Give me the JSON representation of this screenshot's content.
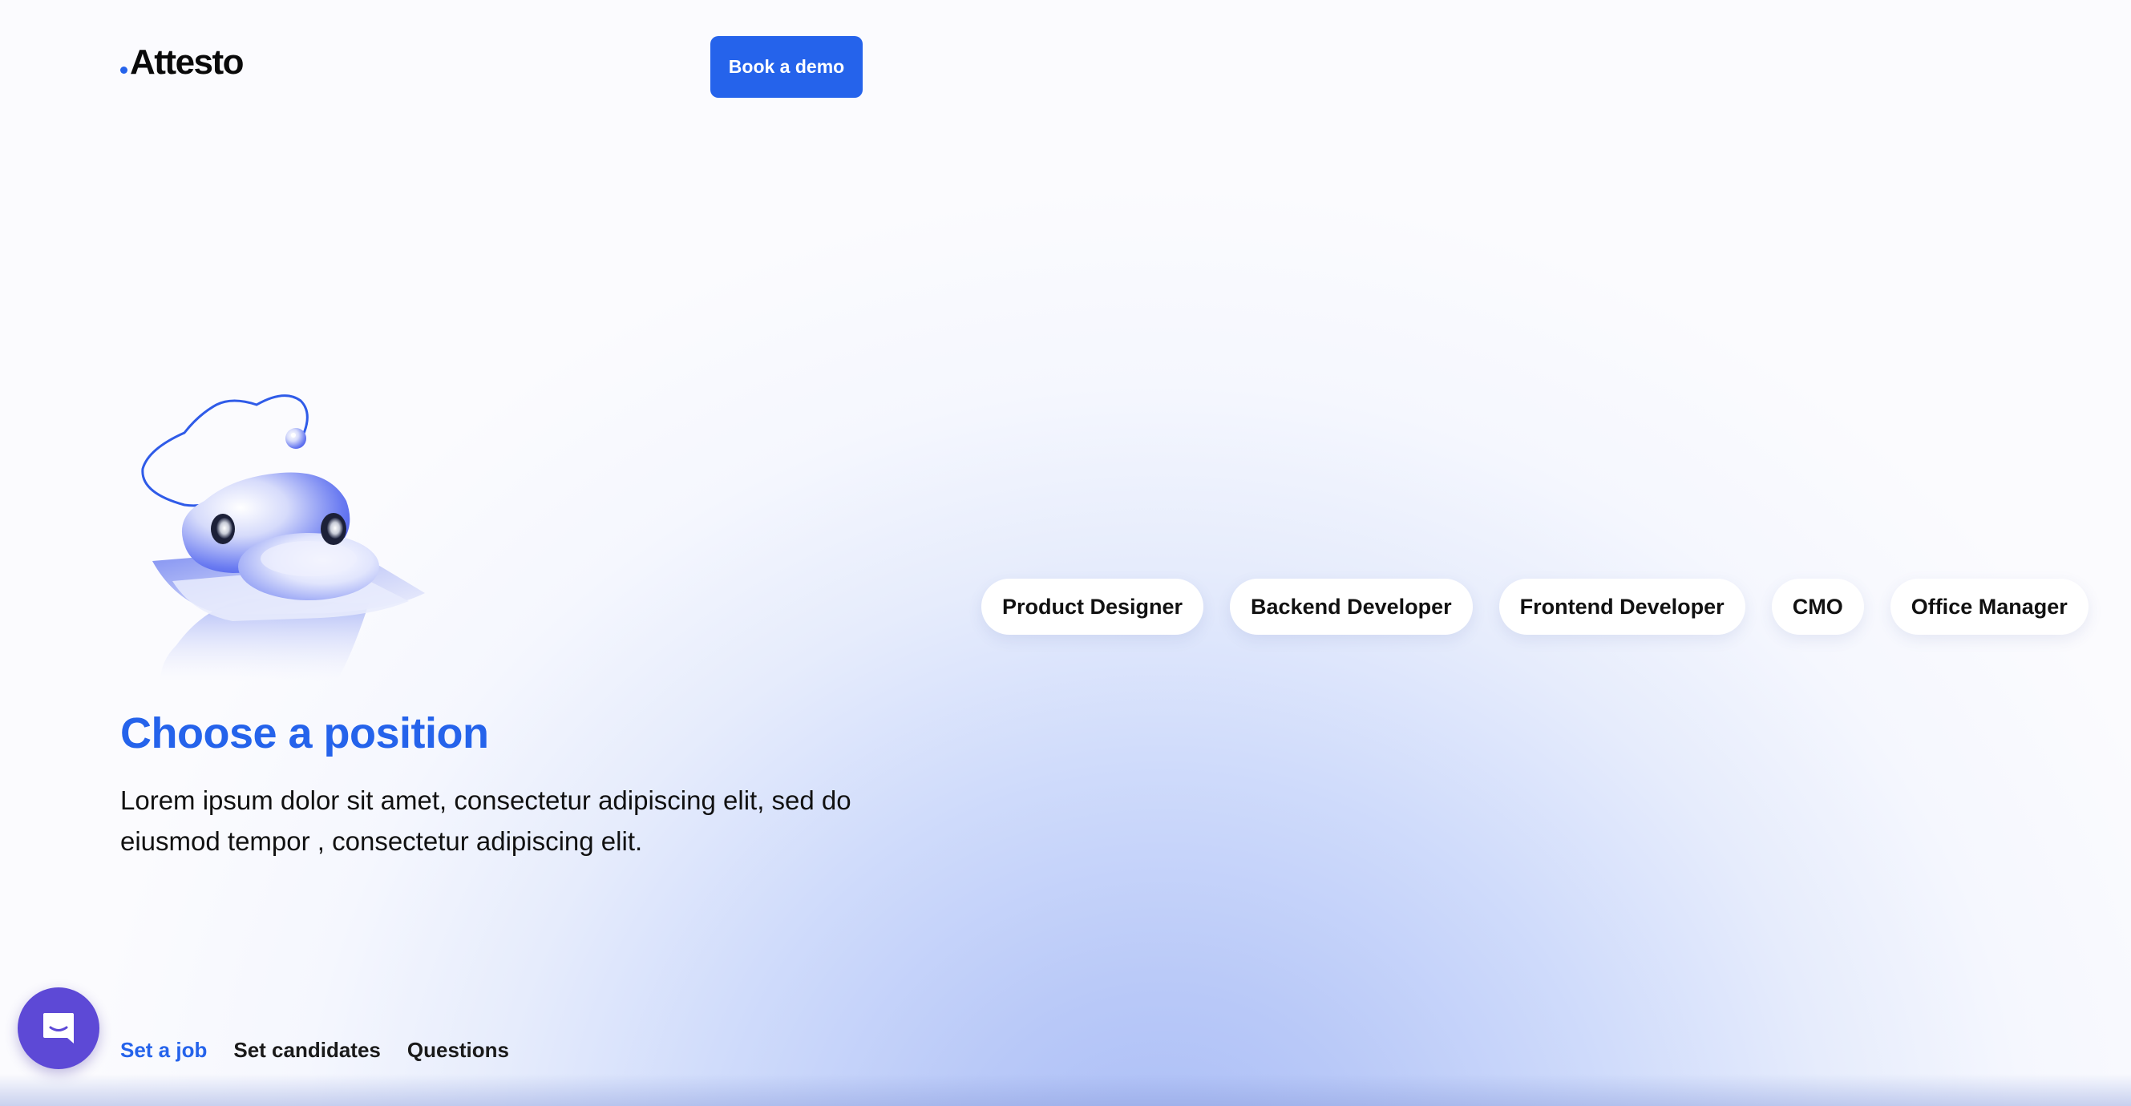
{
  "header": {
    "logo_text": "Attesto",
    "demo_button_label": "Book a demo"
  },
  "hero": {
    "title": "Choose a position",
    "description": "Lorem ipsum dolor sit amet, consectetur adipiscing elit, sed do eiusmod tempor , consectetur adipiscing elit."
  },
  "positions": [
    {
      "label": "Product Designer"
    },
    {
      "label": "Backend Developer"
    },
    {
      "label": "Frontend Developer"
    },
    {
      "label": "CMO"
    },
    {
      "label": "Office Manager"
    }
  ],
  "steps": [
    {
      "label": "Set a job",
      "active": true
    },
    {
      "label": "Set candidates",
      "active": false
    },
    {
      "label": "Questions",
      "active": false
    }
  ],
  "icons": {
    "chat_launcher": "chat-bubble-icon",
    "illustration": "robot-illustration"
  },
  "colors": {
    "accent": "#2563eb",
    "chat_launcher": "#5d49d6",
    "text": "#111111"
  }
}
